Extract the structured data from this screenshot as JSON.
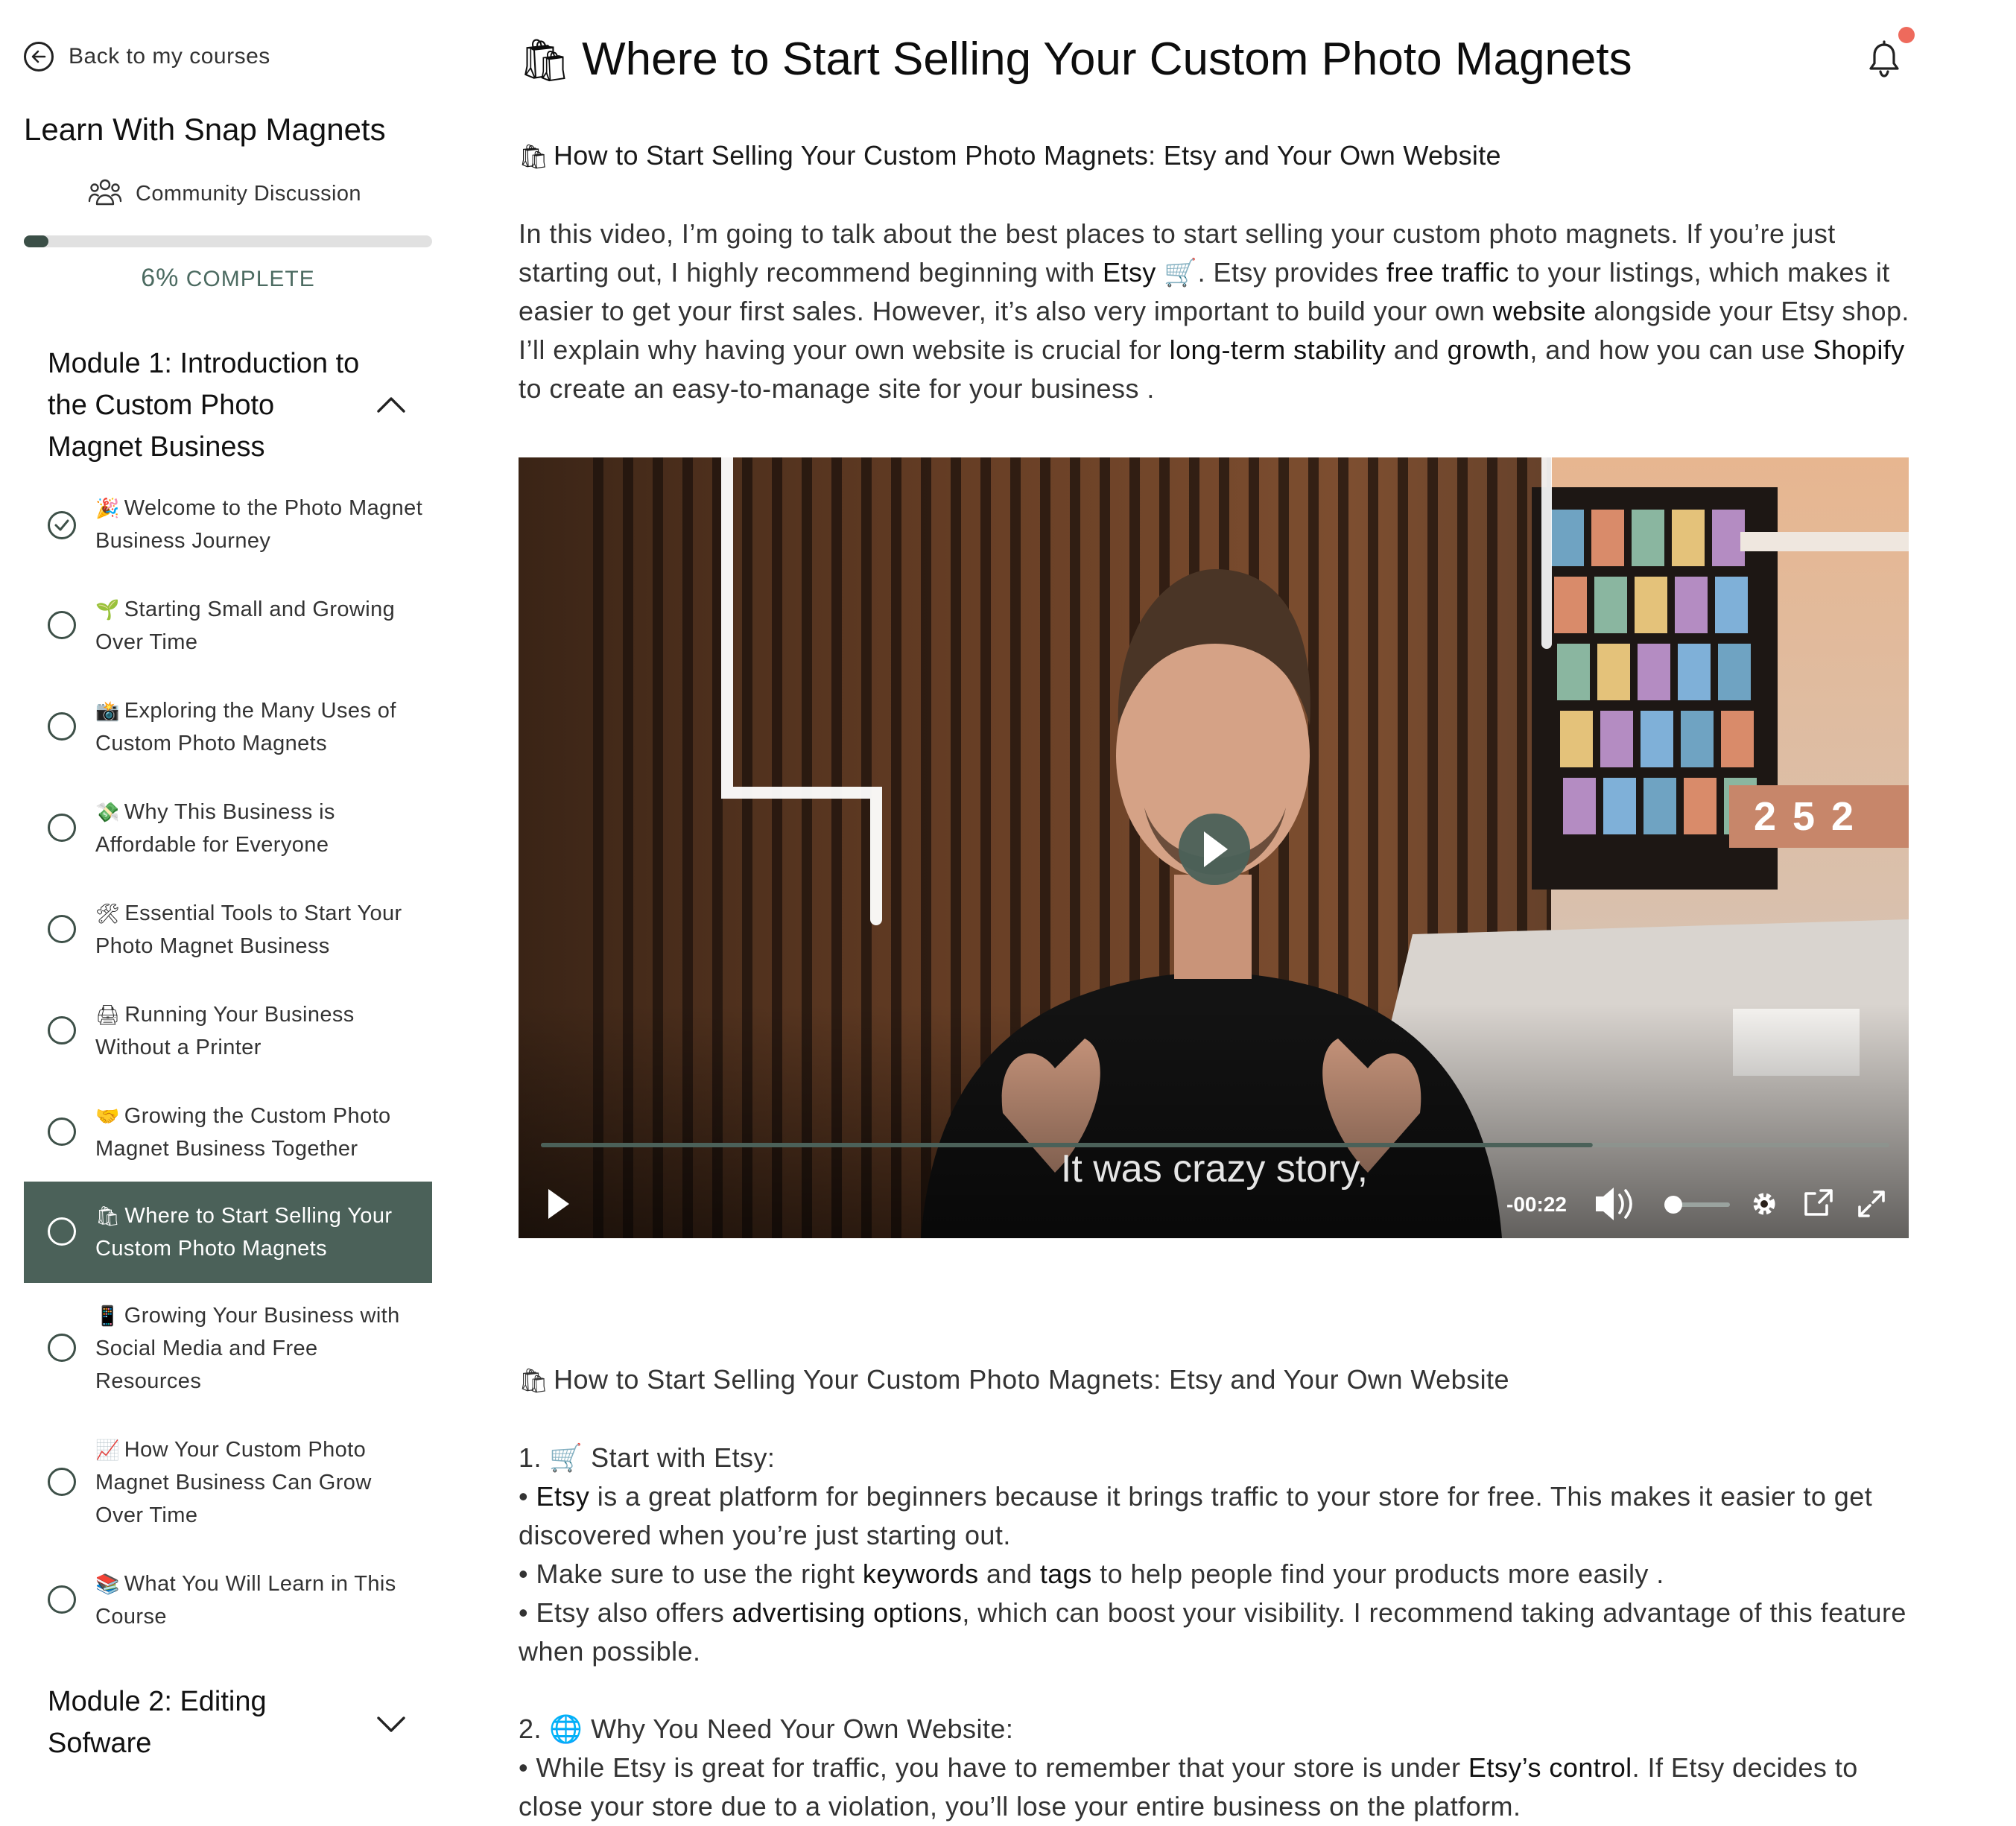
{
  "sidebar": {
    "back_label": "Back to my courses",
    "course_title": "Learn With Snap Magnets",
    "community_label": "Community Discussion",
    "progress": {
      "percent_value": 6,
      "percent": "6%",
      "complete_label": "COMPLETE"
    },
    "modules": [
      {
        "title": "Module 1: Introduction to the Custom Photo Magnet Business",
        "expanded": true
      },
      {
        "title": "Module 2: Editing Sofware",
        "expanded": false
      }
    ],
    "lessons": [
      {
        "emoji": "🎉",
        "label": "Welcome to the Photo Magnet Business Journey",
        "completed": true
      },
      {
        "emoji": "🌱",
        "label": "Starting Small and Growing Over Time",
        "completed": false
      },
      {
        "emoji": "📸",
        "label": "Exploring the Many Uses of Custom Photo Magnets",
        "completed": false
      },
      {
        "emoji": "💸",
        "label": "Why This Business is Affordable for Everyone",
        "completed": false
      },
      {
        "emoji": "🛠",
        "label": "Essential Tools to Start Your Photo Magnet Business",
        "completed": false
      },
      {
        "emoji": "🖨",
        "label": "Running Your Business Without a Printer",
        "completed": false
      },
      {
        "emoji": "🤝",
        "label": "Growing the Custom Photo Magnet Business Together",
        "completed": false
      },
      {
        "emoji": "🛍",
        "label": "Where to Start Selling Your Custom Photo Magnets",
        "completed": false,
        "active": true
      },
      {
        "emoji": "📱",
        "label": "Growing Your Business with Social Media and Free Resources",
        "completed": false
      },
      {
        "emoji": "📈",
        "label": "How Your Custom Photo Magnet Business Can Grow Over Time",
        "completed": false
      },
      {
        "emoji": "📚",
        "label": "What You Will Learn in This Course",
        "completed": false
      }
    ]
  },
  "main": {
    "title_emoji": "🛍",
    "title": "Where to Start Selling Your Custom Photo Magnets",
    "subtitle_emoji": "🛍",
    "subtitle": "How to Start Selling Your Custom Photo Magnets: Etsy and Your Own Website",
    "intro": {
      "s1": "In this video, I’m going to talk about the best places to start selling your custom photo magnets. If you’re just starting out, I highly recommend beginning with",
      "b1": "Etsy",
      "e1": "🛒",
      "s2": ". Etsy provides",
      "b2": "free traffic",
      "s3": "to your listings, which makes it easier to get your first sales. However, it’s also very important to build your own",
      "b3": "website",
      "s4": "alongside your Etsy shop. I’ll explain why having your own website is crucial for",
      "b4": "long-term stability",
      "s5": "and",
      "b5": "growth",
      "s6": ", and how you can use",
      "b6": "Shopify",
      "s7": "to create an easy-to-manage site for your business ."
    },
    "video": {
      "caption": "It was crazy story,",
      "time_remaining": "-00:22",
      "overlay_digits": [
        "2",
        "5",
        "2"
      ],
      "progress_fraction": 0.78,
      "volume_fraction": 0.05
    },
    "notes": {
      "heading_emoji": "🛍",
      "heading": "How to Start Selling Your Custom Photo Magnets: Etsy and Your Own Website",
      "section1_num": "1.",
      "section1_emoji": "🛒",
      "section1_title": "Start with Etsy:",
      "b1_pre": "•",
      "b1_bold": "Etsy",
      "b1_rest": "is a great platform for beginners because it brings traffic to your store for free. This makes it easier to get discovered when you’re just starting out.",
      "b2_pre": "• Make sure to use the right",
      "b2_bold1": "keywords",
      "b2_mid": "and",
      "b2_bold2": "tags",
      "b2_rest": "to help people find your products more easily .",
      "b3_pre": "• Etsy also offers",
      "b3_bold": "advertising options",
      "b3_rest": ", which can boost your visibility. I recommend taking advantage of this feature when possible.",
      "section2_num": "2.",
      "section2_emoji": "🌐",
      "section2_title": "Why You Need Your Own Website:",
      "b4_pre": "• While Etsy is great for traffic, you have to remember that your store is under",
      "b4_bold": "Etsy’s control",
      "b4_rest": ". If Etsy decides to close your store due to a violation, you’ll lose your entire business on the platform."
    }
  },
  "colors": {
    "accent": "#4b6159",
    "progress": "#3b4f47",
    "notification_dot": "#ee6a5c",
    "complete_text": "#4c6b61"
  },
  "icons": {
    "back": "arrow-left-circle-icon",
    "community": "people-icon",
    "expand": "chevron-up-icon",
    "collapse": "chevron-down-icon",
    "bell": "bell-icon",
    "check": "check-circle-icon"
  }
}
